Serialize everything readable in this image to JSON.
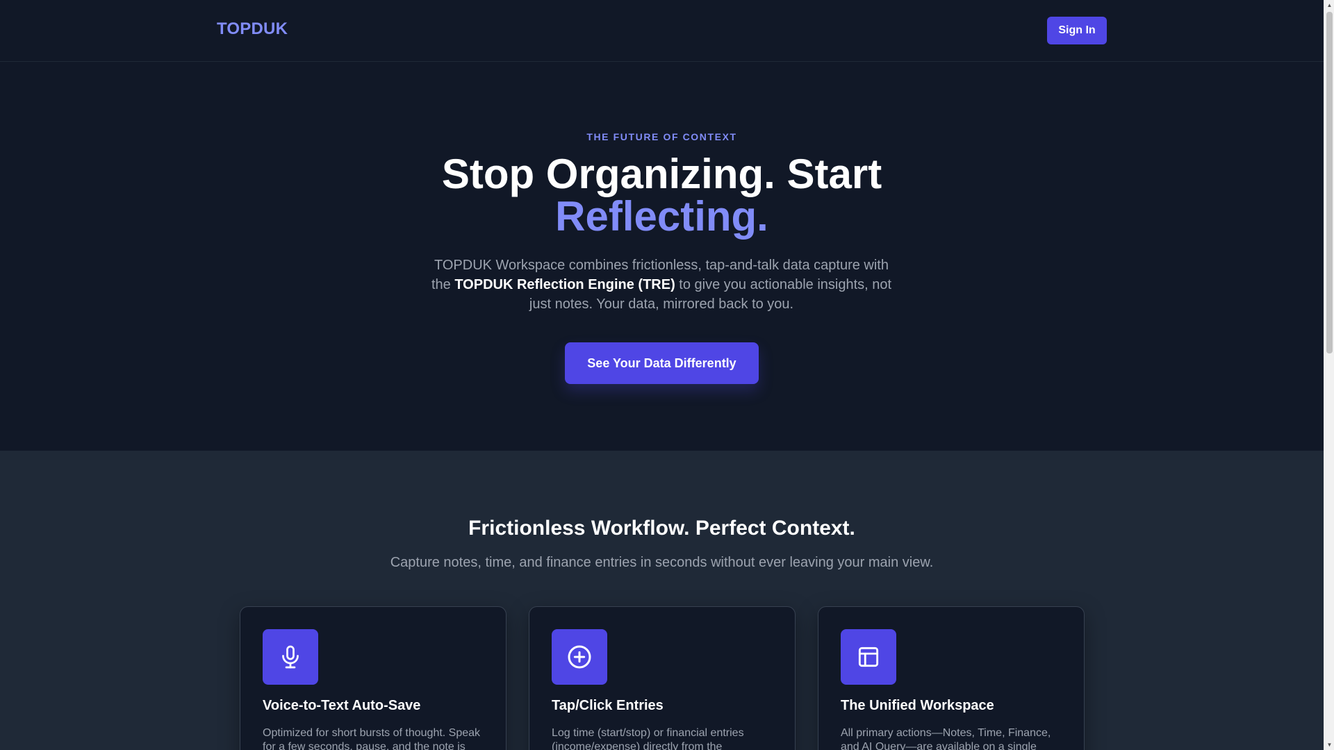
{
  "header": {
    "logo": "TOPDUK",
    "signin_label": "Sign In"
  },
  "hero": {
    "eyebrow": "THE FUTURE OF CONTEXT",
    "headline_line1": "Stop Organizing. Start",
    "headline_accent": "Reflecting.",
    "lede_before": "TOPDUK Workspace combines frictionless, tap-and-talk data capture with the ",
    "lede_strong": "TOPDUK Reflection Engine (TRE)",
    "lede_after": " to give you actionable insights, not just notes. Your data, mirrored back to you.",
    "cta_label": "See Your Data Differently"
  },
  "features": {
    "title": "Frictionless Workflow. Perfect Context.",
    "subtitle": "Capture notes, time, and finance entries in seconds without ever leaving your main view.",
    "cards": [
      {
        "icon": "microphone-icon",
        "title": "Voice-to-Text Auto-Save",
        "desc": "Optimized for short bursts of thought. Speak for a few seconds, pause, and the note is"
      },
      {
        "icon": "plus-circle-icon",
        "title": "Tap/Click Entries",
        "desc": "Log time (start/stop) or financial entries (income/expense) directly from the"
      },
      {
        "icon": "layout-icon",
        "title": "The Unified Workspace",
        "desc": "All primary actions—Notes, Time, Finance, and AI Query—are available on a single"
      }
    ]
  },
  "colors": {
    "background": "#111827",
    "section_alt": "#1f2937",
    "accent": "#818cf8",
    "primary_button": "#4f46e5",
    "muted_text": "#9ca3af"
  }
}
